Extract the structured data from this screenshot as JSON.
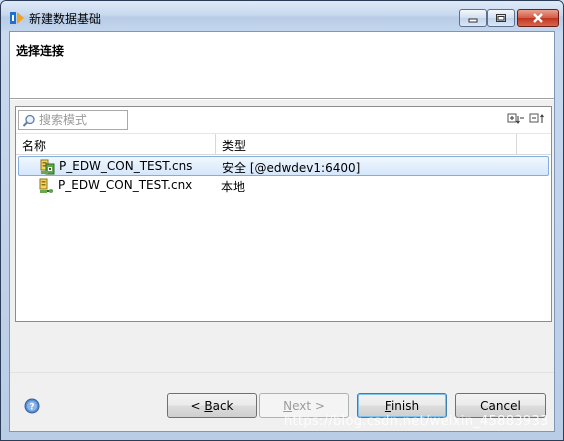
{
  "window": {
    "title": "新建数据基础"
  },
  "banner": {
    "title": "选择连接"
  },
  "search": {
    "placeholder": "搜索模式"
  },
  "table": {
    "columns": [
      "名称",
      "类型"
    ],
    "rows": [
      {
        "name": "P_EDW_CON_TEST.cns",
        "type": "安全 [@edwdev1:6400]",
        "selected": true
      },
      {
        "name": "P_EDW_CON_TEST.cnx",
        "type": "本地",
        "selected": false
      }
    ]
  },
  "buttons": {
    "back": {
      "prefix": "< ",
      "mnemonic": "B",
      "rest": "ack"
    },
    "next": {
      "mnemonic": "N",
      "rest": "ext >"
    },
    "finish": {
      "mnemonic": "F",
      "rest": "inish"
    },
    "cancel": "Cancel"
  },
  "watermark": "https://blog.csdn.net/weixin_45883933",
  "icons": {
    "app": "app-logo-icon",
    "minimize": "minimize-icon",
    "maximize": "maximize-icon",
    "close": "close-icon",
    "search": "search-icon",
    "expand_all": "expand-all-icon",
    "collapse_all": "collapse-all-icon",
    "secure_connection": "secure-connection-icon",
    "local_connection": "local-connection-icon",
    "help": "help-icon"
  },
  "colors": {
    "selection": "#d5e7fb",
    "close_button": "#c0341f"
  }
}
